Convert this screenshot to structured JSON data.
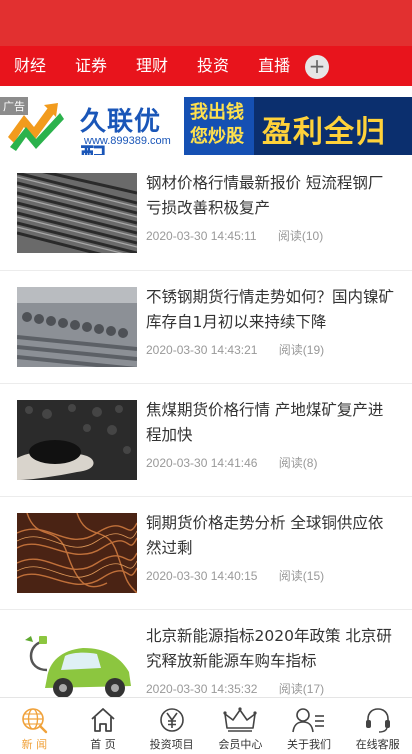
{
  "nav": {
    "items": [
      "财经",
      "证券",
      "理财",
      "投资",
      "直播"
    ],
    "plus": "+"
  },
  "ad": {
    "tag": "广告",
    "brand": "久联优配",
    "url": "www.899389.com",
    "line1": "我出钱",
    "line2": "您炒股",
    "slogan": "盈利全归您"
  },
  "articles": [
    {
      "title": "钢材价格行情最新报价 短流程钢厂亏损改善积极复产",
      "date": "2020-03-30 14:45:11",
      "reads": "阅读(10)",
      "thumb": "rebar-bundle"
    },
    {
      "title": "不锈钢期货行情走势如何？国内镍矿库存自1月初以来持续下降",
      "date": "2020-03-30 14:43:21",
      "reads": "阅读(19)",
      "thumb": "steel-bars"
    },
    {
      "title": "焦煤期货价格行情 产地煤矿复产进程加快",
      "date": "2020-03-30 14:41:46",
      "reads": "阅读(8)",
      "thumb": "coal-in-hand"
    },
    {
      "title": "铜期货价格走势分析 全球铜供应依然过剩",
      "date": "2020-03-30 14:40:15",
      "reads": "阅读(15)",
      "thumb": "copper-wire"
    },
    {
      "title": "北京新能源指标2020年政策 北京研究释放新能源车购车指标",
      "date": "2020-03-30 14:35:32",
      "reads": "阅读(17)",
      "thumb": "green-ev-car"
    }
  ],
  "tabbar": {
    "tabs": [
      {
        "label": "新 闻",
        "icon": "globe-icon",
        "active": true
      },
      {
        "label": "首 页",
        "icon": "home-icon",
        "active": false
      },
      {
        "label": "投资项目",
        "icon": "yen-icon",
        "active": false
      },
      {
        "label": "会员中心",
        "icon": "crown-icon",
        "active": false
      },
      {
        "label": "关于我们",
        "icon": "profile-card-icon",
        "active": false
      },
      {
        "label": "在线客服",
        "icon": "headset-icon",
        "active": false
      }
    ]
  },
  "colors": {
    "header": "#e23030",
    "nav": "#e8141c",
    "active_tab": "#f0a23b"
  }
}
